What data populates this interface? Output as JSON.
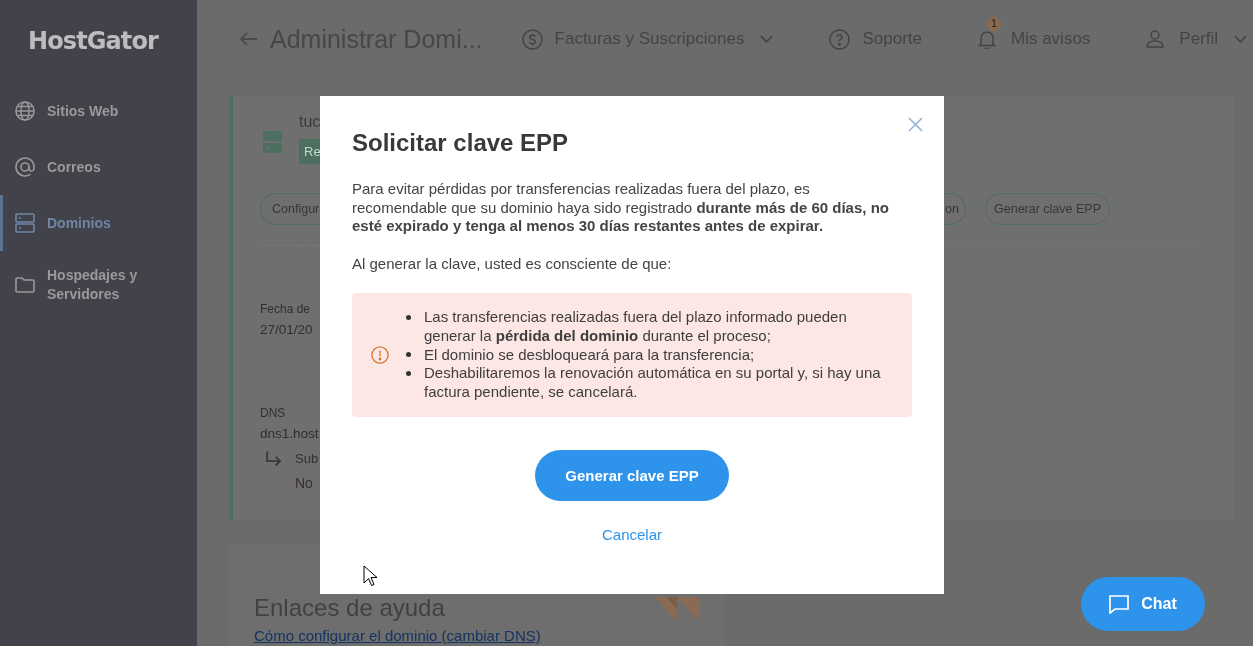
{
  "sidebar": {
    "logo": "HostGator",
    "items": [
      {
        "label": "Sitios Web",
        "selected": false
      },
      {
        "label": "Correos",
        "selected": false
      },
      {
        "label": "Dominios",
        "selected": true
      },
      {
        "label": "Hospedajes y Servidores",
        "selected": false
      }
    ]
  },
  "header": {
    "title": "Administrar Domi...",
    "nav": [
      {
        "label": "Facturas y Suscripciones",
        "dropdown": true
      },
      {
        "label": "Soporte",
        "dropdown": false
      },
      {
        "label": "Mis avisos",
        "dropdown": false,
        "badge": "1"
      },
      {
        "label": "Perfil",
        "dropdown": true
      }
    ]
  },
  "domain_card": {
    "name": "tuc",
    "status": "Re",
    "actions_left": [
      "Configur"
    ],
    "actions_right": [
      "on",
      "Generar clave EPP"
    ],
    "date": {
      "label": "Fecha de",
      "value": "27/01/20"
    },
    "dns": {
      "label": "DNS",
      "value": "dns1.host",
      "sub_label": "Sub",
      "sub_value": "No"
    }
  },
  "help": {
    "title": "Enlaces de ayuda",
    "links": [
      "Cómo configurar el dominio (cambiar DNS)"
    ]
  },
  "modal": {
    "title": "Solicitar clave EPP",
    "intro": "Para evitar pérdidas por transferencias realizadas fuera del plazo, es recomendable que su dominio haya sido registrado **durante más de 60 días, no esté expirado y tenga al menos 30 días restantes antes de expirar.**",
    "lead": "Al generar la clave, usted es consciente de que:",
    "warnings": [
      "Las transferencias realizadas fuera del plazo informado pueden generar la **pérdida del dominio** durante el proceso;",
      "El dominio se desbloqueará para la transferencia;",
      "Deshabilitaremos la renovación automática en su portal y, si hay una factura pendiente, se cancelará."
    ],
    "confirm": "Generar clave EPP",
    "cancel": "Cancelar"
  },
  "chat": {
    "label": "Chat"
  }
}
